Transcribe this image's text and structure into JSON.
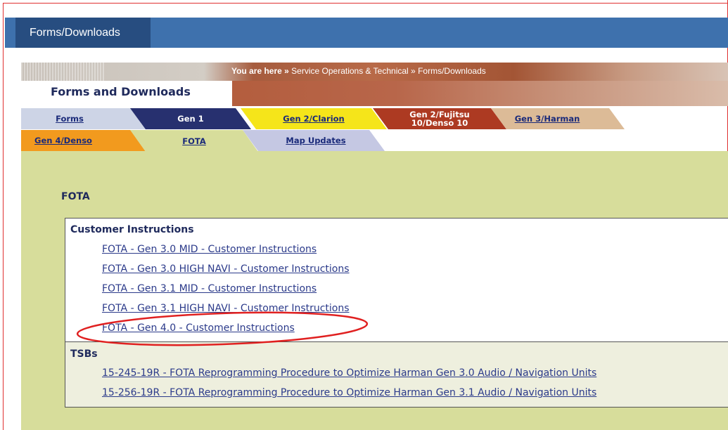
{
  "topbar": {
    "tab_label": "Forms/Downloads"
  },
  "breadcrumb": {
    "prefix": "You are here",
    "separator": "»",
    "item1": "Service Operations & Technical",
    "item2": "Forms/Downloads"
  },
  "section": {
    "title": "Forms and Downloads"
  },
  "tabs_row1": [
    {
      "label": "Forms",
      "bg": "#cdd4e6",
      "color": "#1a2a7a"
    },
    {
      "label": "Gen 1",
      "bg": "#27306f",
      "color": "#ffffff"
    },
    {
      "label": "Gen 2/Clarion",
      "bg": "#f5e51a",
      "color": "#1a2a7a"
    },
    {
      "label_line1": "Gen 2/Fujitsu",
      "label_line2": "10/Denso 10",
      "bg": "#ad3a22",
      "color": "#ffffff"
    },
    {
      "label": "Gen 3/Harman",
      "bg": "#dcbb97",
      "color": "#1a2a7a"
    }
  ],
  "tabs_row2": [
    {
      "label": "Gen 4/Denso",
      "bg": "#f29a1e",
      "color": "#1a2a7a"
    },
    {
      "label": "FOTA",
      "bg": "#d7dd9b",
      "color": "#1a2a7a"
    },
    {
      "label": "Map Updates",
      "bg": "#c5c8e3",
      "color": "#1a2a7a"
    }
  ],
  "fota": {
    "heading": "FOTA",
    "customer_instructions": {
      "title": "Customer Instructions",
      "links": [
        "FOTA - Gen 3.0 MID - Customer Instructions",
        "FOTA - Gen 3.0 HIGH NAVI - Customer Instructions",
        "FOTA - Gen 3.1 MID - Customer Instructions",
        "FOTA - Gen 3.1 HIGH NAVI - Customer Instructions",
        "FOTA - Gen 4.0 - Customer Instructions"
      ]
    },
    "tsbs": {
      "title": "TSBs",
      "links": [
        "15-245-19R - FOTA Reprogramming Procedure to Optimize Harman Gen 3.0 Audio / Navigation Units",
        "15-256-19R - FOTA Reprogramming Procedure to Optimize Harman Gen 3.1 Audio / Navigation Units"
      ]
    }
  },
  "colors": {
    "topbar": "#3e71ad",
    "topbar_tab": "#274d80",
    "content_bg": "#d7dd9b",
    "heading_text": "#1f2a5c",
    "link_text": "#2b3a8a",
    "annotation": "#e02020"
  }
}
